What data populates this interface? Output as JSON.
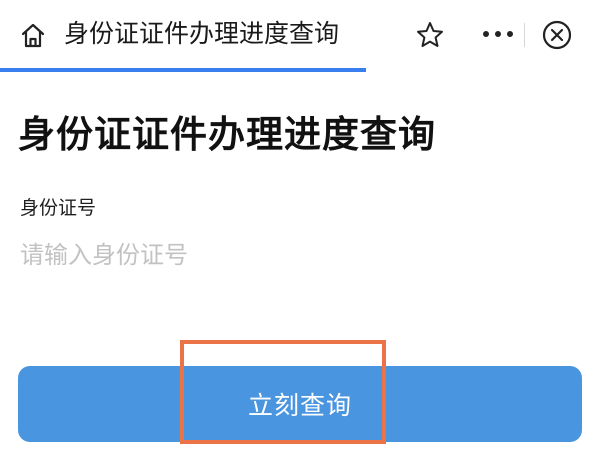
{
  "header": {
    "title": "身份证证件办理进度查询",
    "icons": {
      "home": "home-icon",
      "favorite": "star-icon",
      "more": "more-icon",
      "close": "close-icon"
    },
    "load_progress": 0.61
  },
  "main": {
    "heading": "身份证证件办理进度查询",
    "id_field": {
      "label": "身份证号",
      "placeholder": "请输入身份证号",
      "value": ""
    },
    "submit_label": "立刻查询"
  },
  "colors": {
    "accent": "#3a7ff0",
    "button": "#4a95e0",
    "highlight": "#ea7448"
  }
}
